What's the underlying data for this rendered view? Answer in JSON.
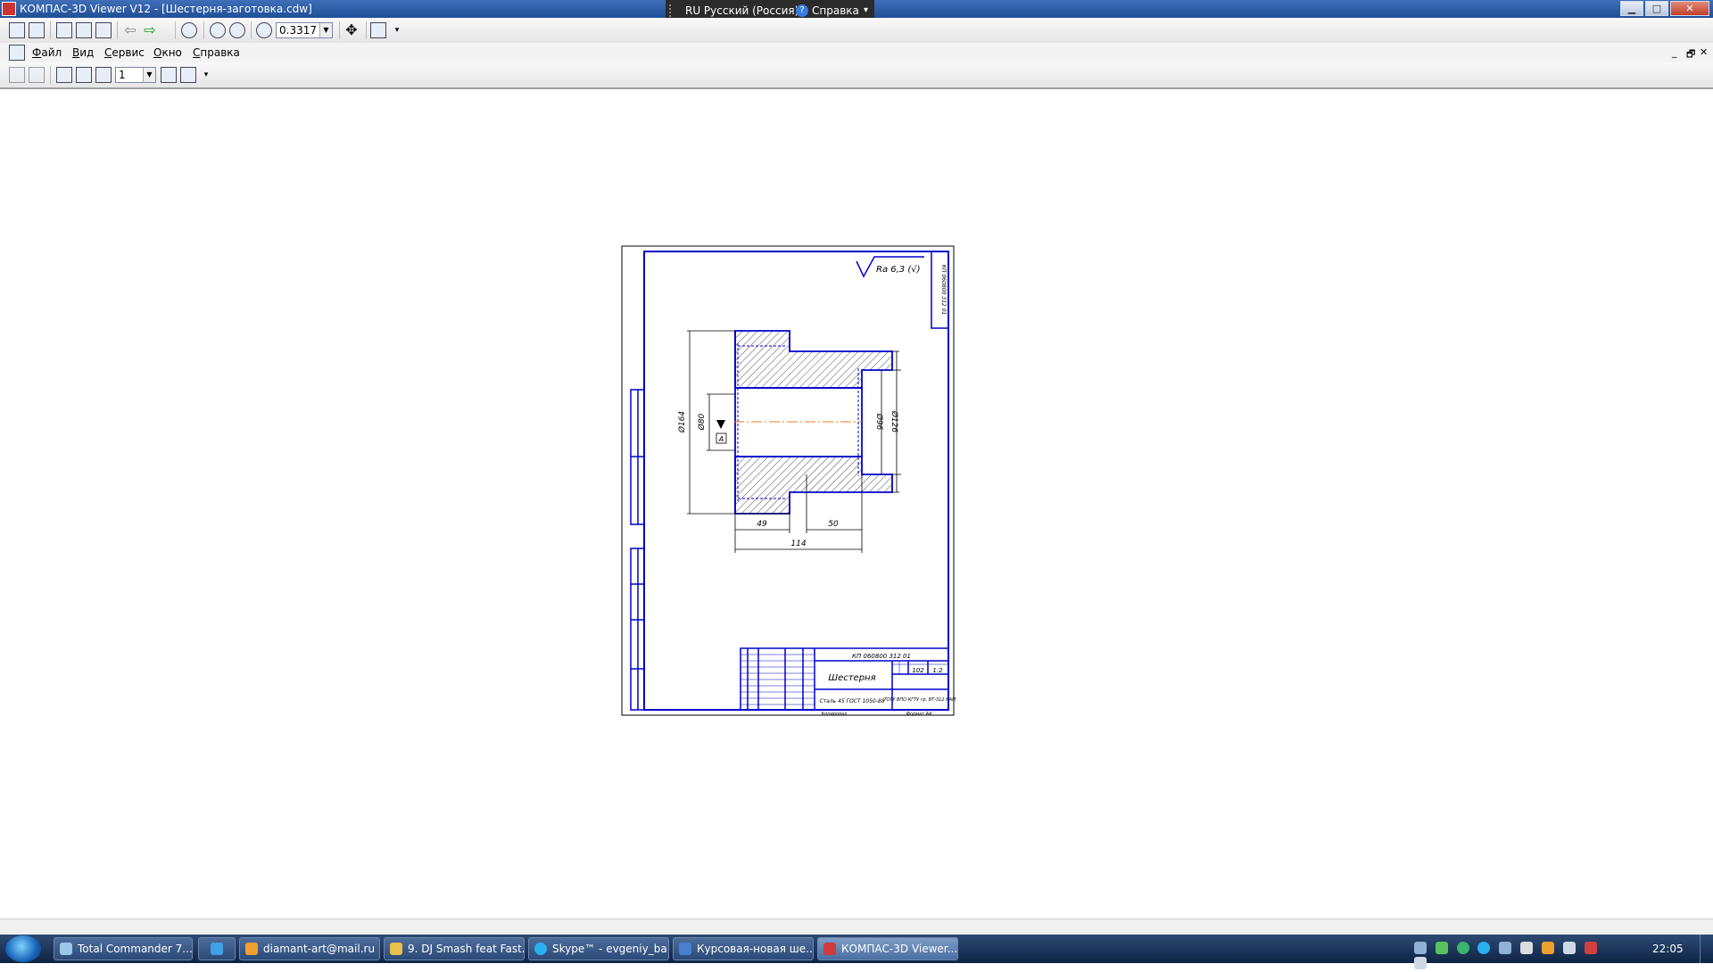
{
  "window": {
    "title": "КОМПАС-3D Viewer V12 - [Шестерня-заготовка.cdw]",
    "minimize": "▁",
    "maximize": "□",
    "close": "✕"
  },
  "langbar": {
    "language": "RU Русский (Россия)",
    "help": "Справка"
  },
  "toolbar": {
    "zoom_value": "0.3317",
    "page_value": "1"
  },
  "menu": {
    "items": [
      "Файл",
      "Вид",
      "Сервис",
      "Окно",
      "Справка"
    ]
  },
  "mdi_controls": [
    "_",
    "🗗",
    "✕"
  ],
  "drawing": {
    "roughness": "Ra 6,3 (√)",
    "side_code": "КП 060800 312 01",
    "dims": {
      "d_outer": "Ø164",
      "d_bore": "Ø80",
      "d_hub_outer": "Ø126",
      "d_hub_inner": "Ø96",
      "len_49": "49",
      "len_50": "50",
      "len_114": "114",
      "datum": "А"
    },
    "stamp": {
      "doc_code": "КП 060800 312 01",
      "part_name": "Шестерня",
      "material": "Сталь 45 ГОСТ 1050-88",
      "mass": "102",
      "scale": "1:2",
      "org": "ТОГУ ВПО КГТУ гр. ВТ-312 КАМ",
      "format": "Формат А4",
      "copied": "Копировал"
    }
  },
  "taskbar": {
    "items": [
      "Total Commander 7....",
      "",
      "diamant-art@mail.ru",
      "9. DJ Smash feat Fast...",
      "Skype™ - evgeniy_ba...",
      "Курсовая-новая ше...",
      "КОМПАС-3D Viewer..."
    ],
    "clock": "22:05"
  }
}
